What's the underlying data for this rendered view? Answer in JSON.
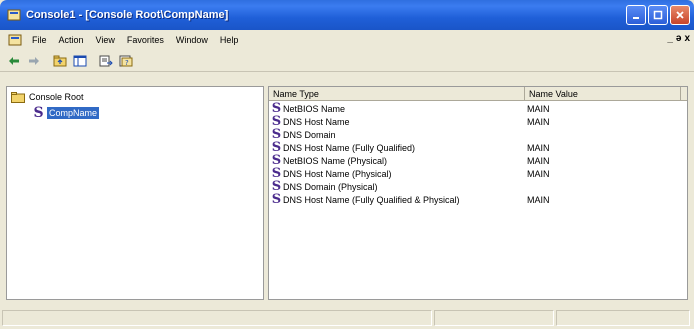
{
  "window": {
    "title": "Console1 - [Console Root\\CompName]"
  },
  "menubar": {
    "items": [
      "File",
      "Action",
      "View",
      "Favorites",
      "Window",
      "Help"
    ],
    "mdi_controls": [
      "_",
      "ə",
      "x"
    ]
  },
  "toolbar": {
    "icons": [
      "back-arrow-icon",
      "forward-arrow-icon",
      "up-folder-icon",
      "show-hide-tree-icon",
      "export-list-icon",
      "help-icon"
    ]
  },
  "tree": {
    "root_label": "Console Root",
    "child_label": "CompName",
    "child_icon_glyph": "S"
  },
  "list": {
    "columns": [
      "Name Type",
      "Name Value"
    ],
    "icon_glyph": "S",
    "rows": [
      {
        "type": "NetBIOS Name",
        "value": "MAIN"
      },
      {
        "type": "DNS Host Name",
        "value": "MAIN"
      },
      {
        "type": "DNS Domain",
        "value": ""
      },
      {
        "type": "DNS Host Name (Fully Qualified)",
        "value": "MAIN"
      },
      {
        "type": "NetBIOS Name (Physical)",
        "value": "MAIN"
      },
      {
        "type": "DNS Host Name (Physical)",
        "value": "MAIN"
      },
      {
        "type": "DNS Domain (Physical)",
        "value": ""
      },
      {
        "type": "DNS Host Name (Fully Qualified & Physical)",
        "value": "MAIN"
      }
    ]
  },
  "colors": {
    "title_bar": "#1f5fd8",
    "selection": "#316ac5",
    "snapin_icon": "#4a2a8c"
  }
}
